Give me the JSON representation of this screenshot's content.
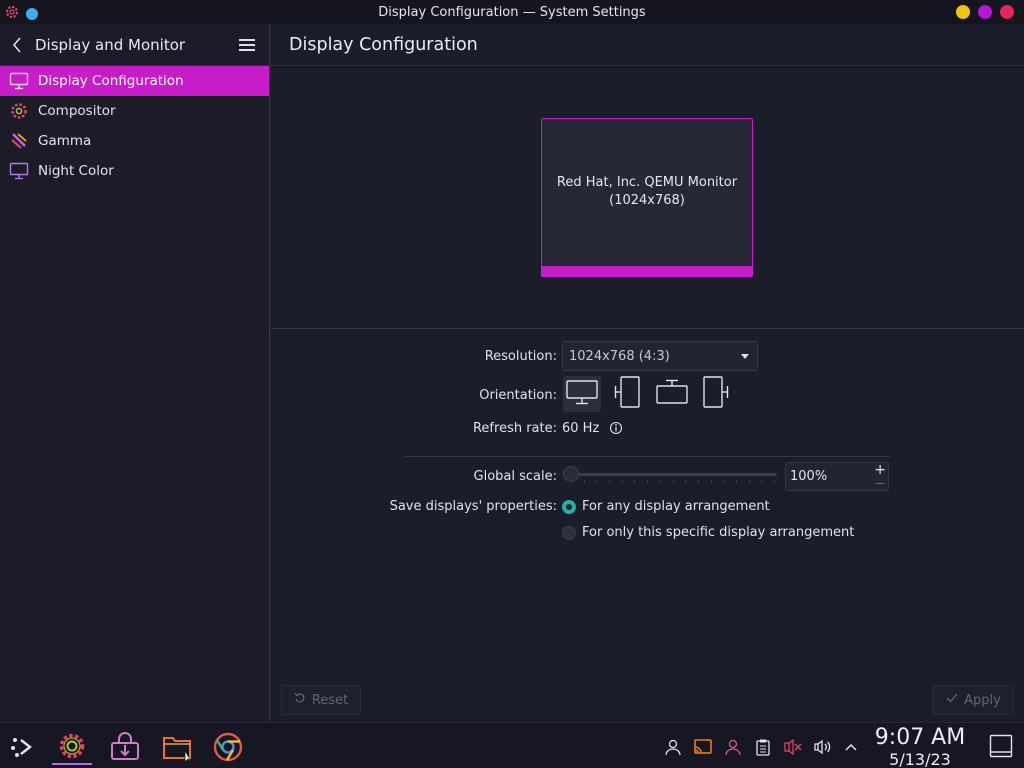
{
  "window": {
    "title": "Display Configuration — System Settings"
  },
  "sidebar": {
    "header": "Display and Monitor",
    "items": [
      {
        "label": "Display Configuration",
        "icon": "monitor-icon",
        "active": true
      },
      {
        "label": "Compositor",
        "icon": "gear-icon"
      },
      {
        "label": "Gamma",
        "icon": "brush-icon"
      },
      {
        "label": "Night Color",
        "icon": "monitor-icon"
      }
    ]
  },
  "main": {
    "title": "Display Configuration",
    "monitor": {
      "name": "Red Hat, Inc. QEMU Monitor",
      "resolution": "(1024x768)"
    },
    "resolution_label": "Resolution:",
    "resolution_value": "1024x768 (4:3)",
    "orientation_label": "Orientation:",
    "refresh_label": "Refresh rate:",
    "refresh_value": "60 Hz",
    "scale_label": "Global scale:",
    "scale_value": "100%",
    "save_label": "Save displays' properties:",
    "save_options": [
      "For any display arrangement",
      "For only this specific display arrangement"
    ],
    "save_selected": 0,
    "reset_label": "Reset",
    "apply_label": "Apply"
  },
  "taskbar": {
    "time": "9:07 AM",
    "date": "5/13/23"
  },
  "colors": {
    "accent": "#c61dc8",
    "radio": "#22b3a2",
    "background": "#1c1d2a"
  }
}
